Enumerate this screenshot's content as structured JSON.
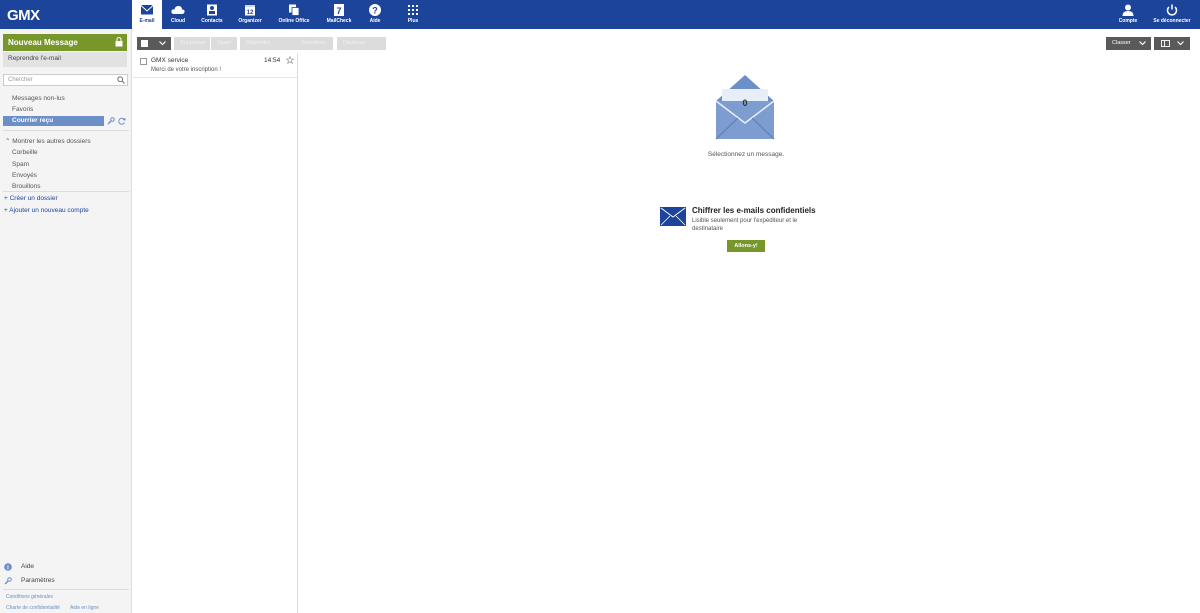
{
  "app": {
    "logo": "GMX"
  },
  "nav": [
    {
      "label": "E-mail",
      "icon": "mail-icon",
      "active": true
    },
    {
      "label": "Cloud",
      "icon": "cloud-icon"
    },
    {
      "label": "Contacts",
      "icon": "contacts-icon"
    },
    {
      "label": "Organizer",
      "icon": "calendar-icon"
    },
    {
      "label": "Online Office",
      "icon": "office-icon"
    },
    {
      "label": "MailCheck",
      "icon": "mailcheck-icon",
      "badge": "7"
    },
    {
      "label": "Aide",
      "icon": "help-icon"
    },
    {
      "label": "Plus",
      "icon": "grid-icon"
    }
  ],
  "nav_right": [
    {
      "label": "Compte",
      "icon": "user-icon"
    },
    {
      "label": "Se déconnecter",
      "icon": "power-icon"
    }
  ],
  "sidebar": {
    "new_message": "Nouveau Message",
    "resume_email": "Reprendre l'e-mail",
    "search_placeholder": "Chercher",
    "folders": [
      "Messages non-lus",
      "Favoris",
      "Courrier reçu"
    ],
    "show_other": "Montrer les autres dossiers",
    "other_folders": [
      "Corbeille",
      "Spam",
      "Envoyés",
      "Brouillons"
    ],
    "create_folder": "Créer un dossier",
    "add_account": "Ajouter un nouveau compte",
    "help": "Aide",
    "settings": "Paramètres",
    "legal": [
      "Conditions générales",
      "Charte de confidentialité",
      "Aide en ligne"
    ]
  },
  "toolbar": {
    "buttons": [
      "Supprimer",
      "Spam",
      "Répondre",
      "Transférer",
      "Déplacer"
    ],
    "sort": "Classer"
  },
  "messages": [
    {
      "sender": "GMX service",
      "time": "14:54",
      "subject": "Merci de votre inscription !"
    }
  ],
  "main": {
    "envelope_count": "0",
    "select_message": "Sélectionnez un message.",
    "promo_title": "Chiffrer les e-mails confidentiels",
    "promo_desc": "Lisible seulement pour l'expéditeur et le destinataire",
    "promo_button": "Allons-y!"
  },
  "colors": {
    "brand": "#1c449b",
    "accent": "#77972b",
    "selected": "#6d8fc7"
  }
}
